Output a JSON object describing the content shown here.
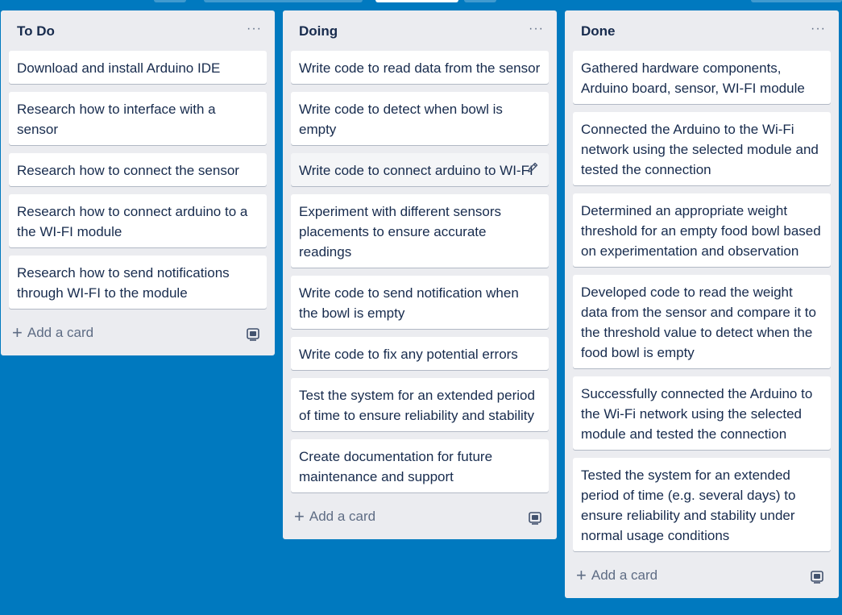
{
  "lists": [
    {
      "title": "To Do",
      "menu": "···",
      "cards": [
        "Download and install Arduino IDE",
        "Research how to interface with a sensor",
        "Research how to connect the sensor",
        "Research how to connect arduino to a the WI-FI module",
        "Research how to send notifications through WI-FI to the module"
      ],
      "add_label": "Add a card"
    },
    {
      "title": "Doing",
      "menu": "···",
      "cards": [
        "Write code to read data from the sensor",
        "Write code to detect when bowl is empty",
        "Write code to connect arduino to WI-FI",
        "Experiment with different sensors placements to ensure accurate readings",
        "Write code to send notification when the bowl is empty",
        "Write code to fix any potential errors",
        "Test the system for an extended period of time to ensure reliability and stability",
        "Create documentation for future maintenance and support"
      ],
      "add_label": "Add a card"
    },
    {
      "title": "Done",
      "menu": "···",
      "cards": [
        "Gathered hardware components, Arduino board, sensor, WI-FI module",
        "Connected the Arduino to the Wi-Fi network using the selected module and tested the connection",
        "Determined an appropriate weight threshold for an empty food bowl based on experimentation and observation",
        "Developed code to read the weight data from the sensor and compare it to the threshold value to detect when the food bowl is empty",
        "Successfully connected the Arduino to the Wi-Fi network using the selected module and tested the connection",
        "Tested the system for an extended period of time (e.g. several days) to ensure reliability and stability under normal usage conditions"
      ],
      "add_label": "Add a card"
    }
  ],
  "icons": {
    "menu": "more-horizontal-icon",
    "add": "plus-icon",
    "template": "card-template-icon",
    "edit": "pencil-icon"
  },
  "colors": {
    "board_background": "#0079bf",
    "list_background": "#ebecf0",
    "card_background": "#ffffff",
    "text": "#172b4d",
    "muted_text": "#5e6c84"
  }
}
